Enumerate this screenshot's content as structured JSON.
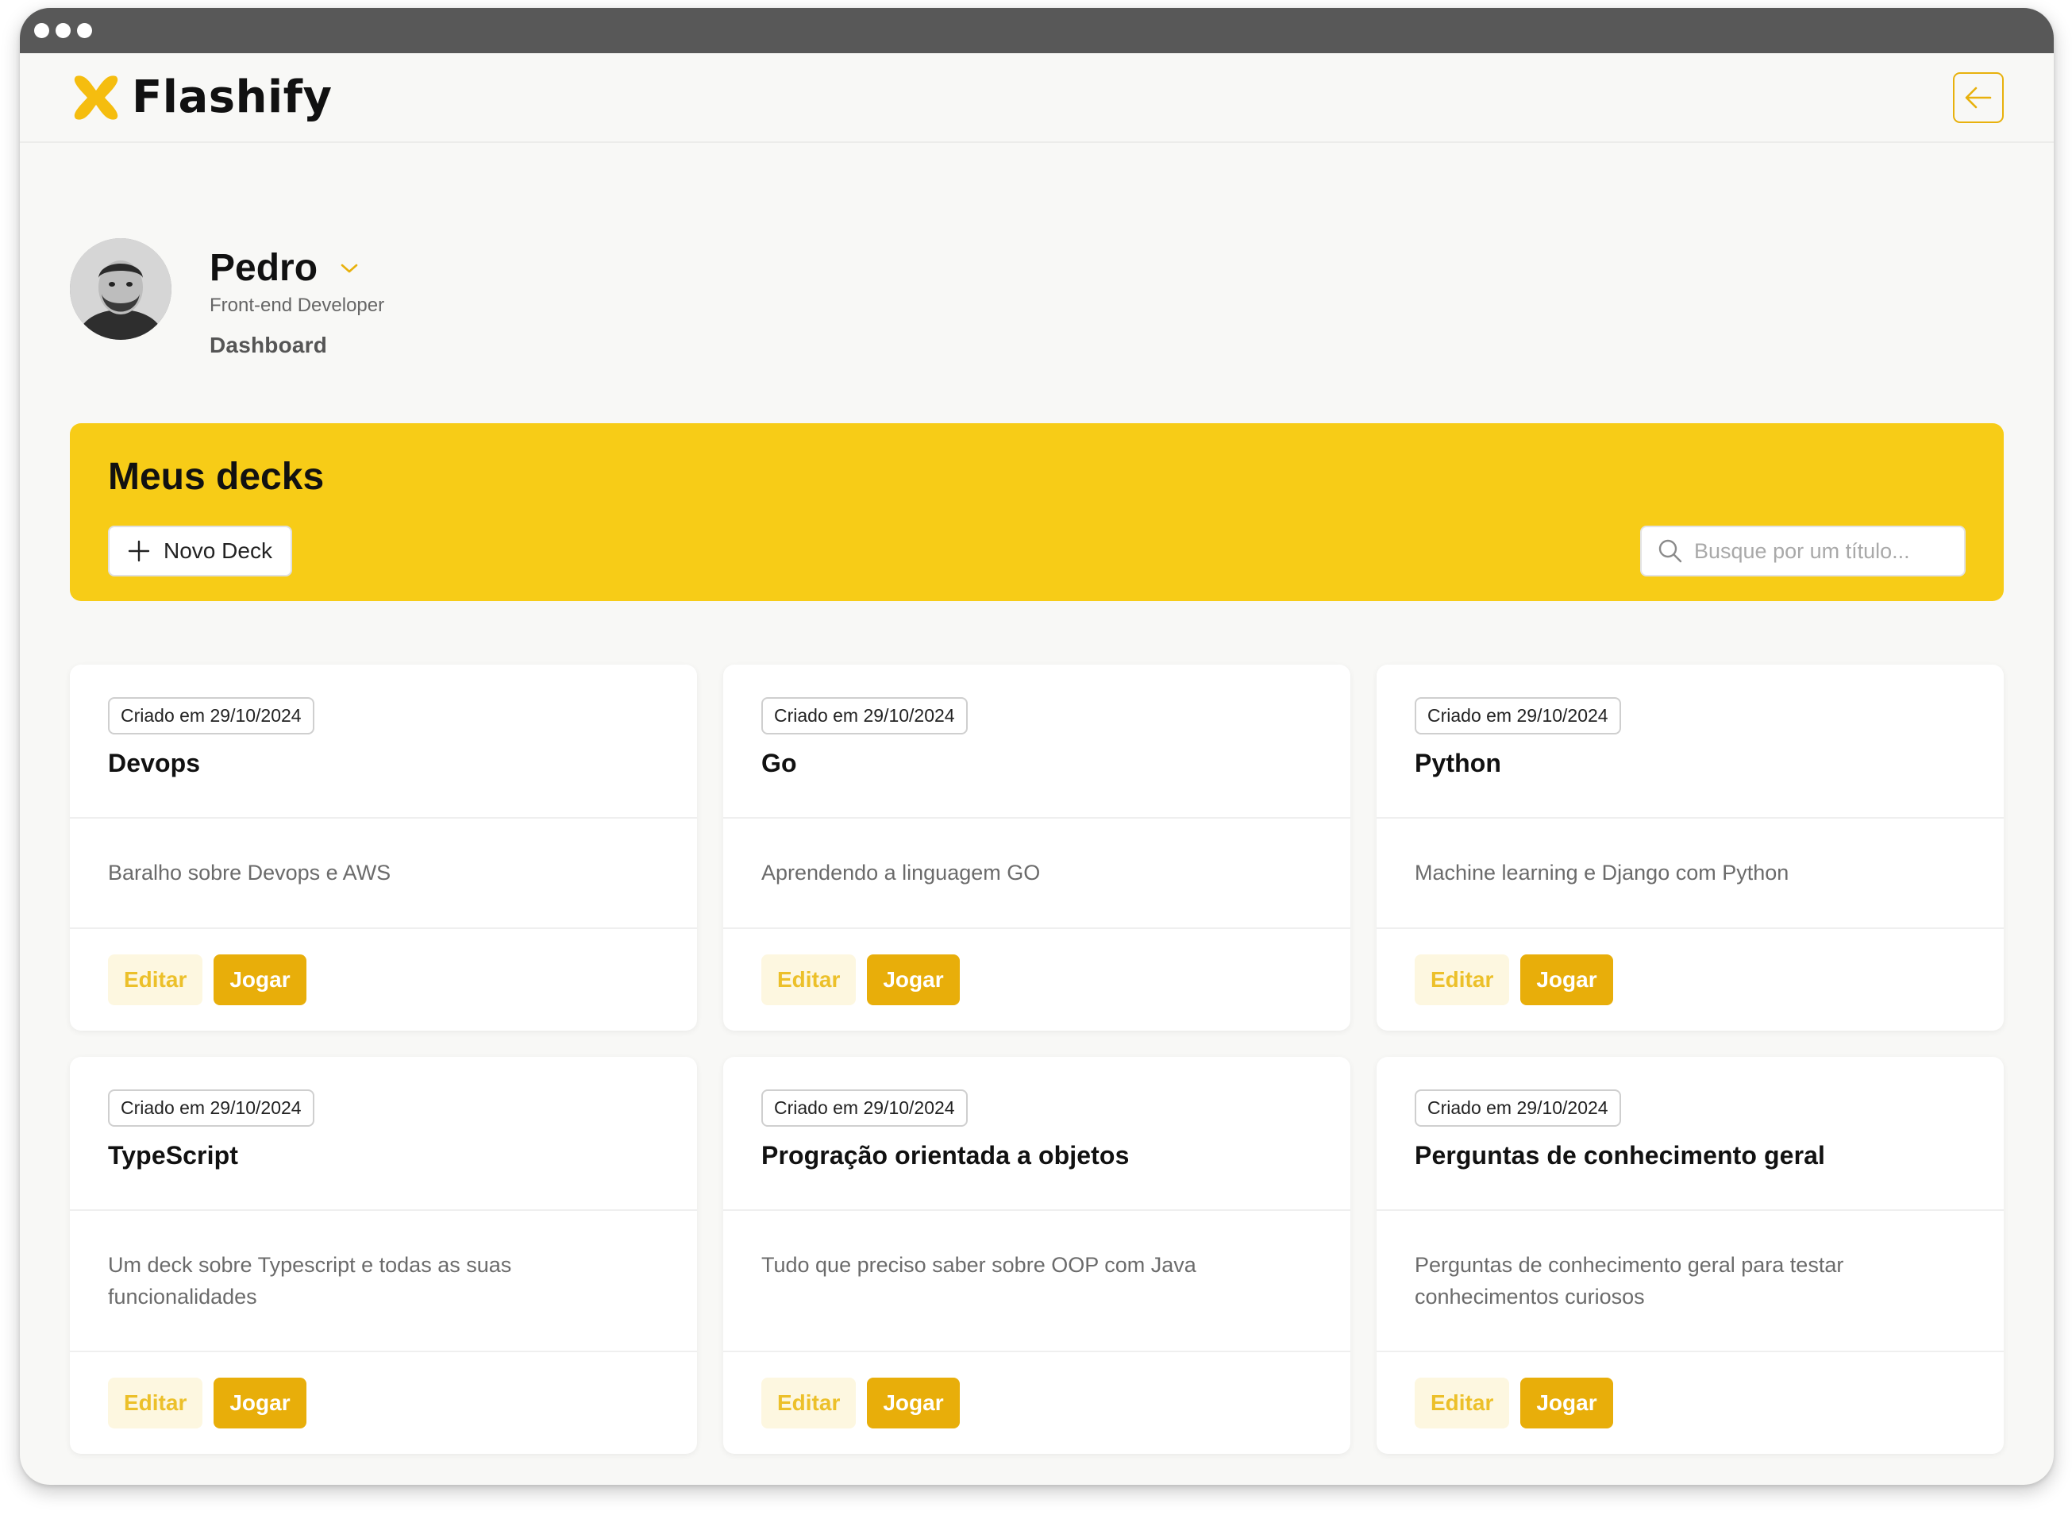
{
  "app": {
    "name": "Flashify"
  },
  "profile": {
    "name": "Pedro",
    "role": "Front-end Developer",
    "nav_link": "Dashboard"
  },
  "banner": {
    "title": "Meus decks",
    "new_deck_label": "Novo Deck",
    "search_placeholder": "Busque por um título..."
  },
  "cards": [
    {
      "date": "Criado em 29/10/2024",
      "title": "Devops",
      "description": "Baralho sobre Devops e AWS",
      "edit_label": "Editar",
      "play_label": "Jogar"
    },
    {
      "date": "Criado em 29/10/2024",
      "title": "Go",
      "description": "Aprendendo a linguagem GO",
      "edit_label": "Editar",
      "play_label": "Jogar"
    },
    {
      "date": "Criado em 29/10/2024",
      "title": "Python",
      "description": "Machine learning e Django com Python",
      "edit_label": "Editar",
      "play_label": "Jogar"
    },
    {
      "date": "Criado em 29/10/2024",
      "title": "TypeScript",
      "description": "Um deck sobre Typescript e todas as suas funcionalidades",
      "edit_label": "Editar",
      "play_label": "Jogar"
    },
    {
      "date": "Criado em 29/10/2024",
      "title": "Progração orientada a objetos",
      "description": "Tudo que preciso saber sobre OOP com Java",
      "edit_label": "Editar",
      "play_label": "Jogar"
    },
    {
      "date": "Criado em 29/10/2024",
      "title": "Perguntas de conhecimento geral",
      "description": "Perguntas de conhecimento geral para testar conhecimentos curiosos",
      "edit_label": "Editar",
      "play_label": "Jogar"
    }
  ],
  "colors": {
    "brand_yellow": "#f7cc17",
    "accent_gold": "#e8ae0a",
    "edit_bg": "#fdf7e0",
    "titlebar": "#585858"
  },
  "icons": {
    "logo": "flashify-x-logo-icon",
    "logout": "arrow-left-icon",
    "dropdown": "chevron-down-icon",
    "add": "plus-icon",
    "search": "search-icon"
  }
}
